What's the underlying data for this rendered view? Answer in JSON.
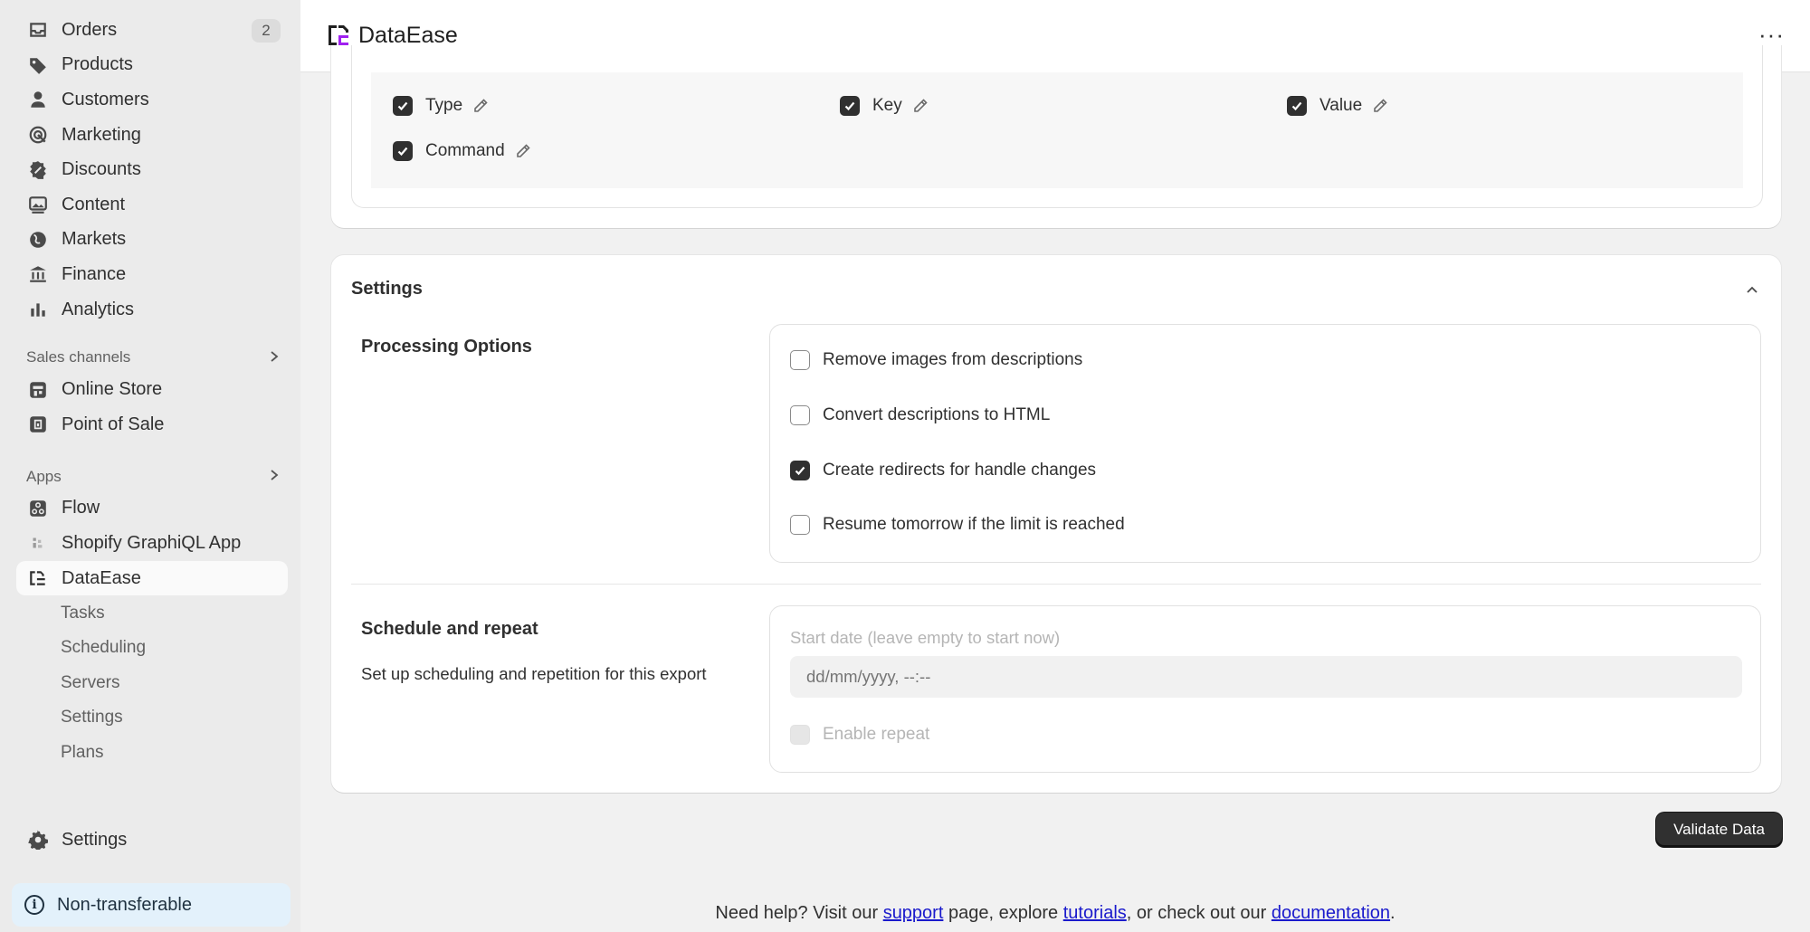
{
  "sidebar": {
    "items": [
      {
        "label": "Orders",
        "icon": "inbox-icon",
        "badge": "2"
      },
      {
        "label": "Products",
        "icon": "tag-icon"
      },
      {
        "label": "Customers",
        "icon": "person-icon"
      },
      {
        "label": "Marketing",
        "icon": "target-icon"
      },
      {
        "label": "Discounts",
        "icon": "discount-icon"
      },
      {
        "label": "Content",
        "icon": "image-icon"
      },
      {
        "label": "Markets",
        "icon": "globe-icon"
      },
      {
        "label": "Finance",
        "icon": "bank-icon"
      },
      {
        "label": "Analytics",
        "icon": "bar-chart-icon"
      }
    ],
    "sales_channels": {
      "label": "Sales channels",
      "items": [
        {
          "label": "Online Store",
          "icon": "store-icon"
        },
        {
          "label": "Point of Sale",
          "icon": "pos-icon"
        }
      ]
    },
    "apps": {
      "label": "Apps",
      "items": [
        {
          "label": "Flow",
          "icon": "flow-icon"
        },
        {
          "label": "Shopify GraphiQL App",
          "icon": "graphiql-icon"
        },
        {
          "label": "DataEase",
          "icon": "dataease-icon"
        }
      ],
      "sub_items": [
        "Tasks",
        "Scheduling",
        "Servers",
        "Settings",
        "Plans"
      ]
    },
    "settings_label": "Settings",
    "notice": "Non-transferable"
  },
  "topbar": {
    "title": "DataEase",
    "more_label": "···"
  },
  "columns": {
    "items": [
      {
        "label": "Type",
        "checked": true
      },
      {
        "label": "Key",
        "checked": true
      },
      {
        "label": "Value",
        "checked": true
      },
      {
        "label": "Command",
        "checked": true
      }
    ]
  },
  "settings": {
    "title": "Settings",
    "processing": {
      "title": "Processing Options",
      "options": [
        {
          "label": "Remove images from descriptions",
          "checked": false
        },
        {
          "label": "Convert descriptions to HTML",
          "checked": false
        },
        {
          "label": "Create redirects for handle changes",
          "checked": true
        },
        {
          "label": "Resume tomorrow if the limit is reached",
          "checked": false
        }
      ]
    },
    "schedule": {
      "title": "Schedule and repeat",
      "description": "Set up scheduling and repetition for this export",
      "start_date_label": "Start date (leave empty to start now)",
      "start_date_placeholder": "dd/mm/yyyy, --:--",
      "enable_repeat_label": "Enable repeat"
    }
  },
  "actions": {
    "validate_label": "Validate Data"
  },
  "footer": {
    "prefix": "Need help? Visit our ",
    "support": "support",
    "middle1": " page, explore ",
    "tutorials": "tutorials",
    "middle2": ", or check out our ",
    "documentation": "documentation",
    "suffix": "."
  },
  "colors": {
    "accent_dark": "#303030",
    "link": "#1a1acc",
    "notice_bg": "#e3f1fb",
    "logo_purple": "#a020f0"
  }
}
